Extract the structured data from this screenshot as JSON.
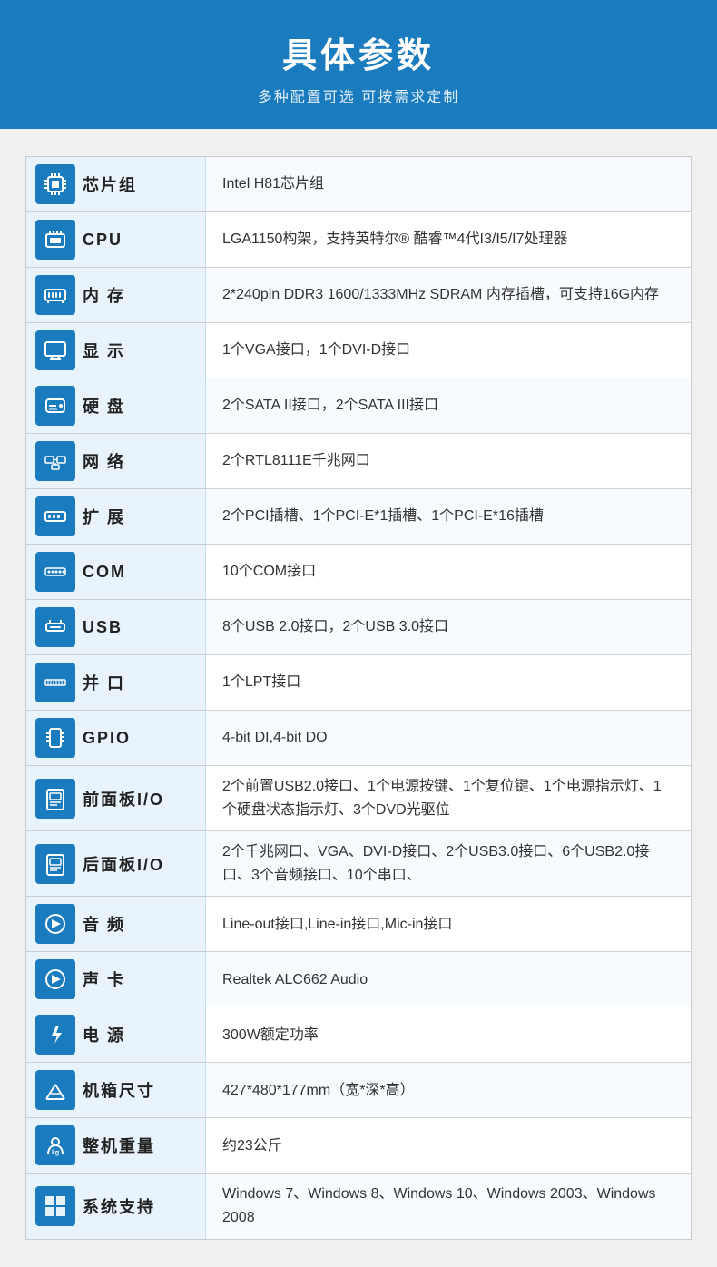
{
  "header": {
    "title": "具体参数",
    "subtitle": "多种配置可选 可按需求定制"
  },
  "rows": [
    {
      "id": "chipset",
      "icon": "🔲",
      "label": "芯片组",
      "value": "Intel H81芯片组"
    },
    {
      "id": "cpu",
      "icon": "🖥",
      "label": "CPU",
      "value": "LGA1150构架，支持英特尔® 酷睿™4代I3/I5/I7处理器"
    },
    {
      "id": "memory",
      "icon": "▦",
      "label": "内 存",
      "value": "2*240pin DDR3 1600/1333MHz SDRAM 内存插槽，可支持16G内存"
    },
    {
      "id": "display",
      "icon": "🖵",
      "label": "显 示",
      "value": "1个VGA接口，1个DVI-D接口"
    },
    {
      "id": "harddisk",
      "icon": "💽",
      "label": "硬 盘",
      "value": "2个SATA II接口，2个SATA III接口"
    },
    {
      "id": "network",
      "icon": "🖧",
      "label": "网 络",
      "value": "2个RTL8111E千兆网口"
    },
    {
      "id": "expand",
      "icon": "▣",
      "label": "扩 展",
      "value": "2个PCI插槽、1个PCI-E*1插槽、1个PCI-E*16插槽"
    },
    {
      "id": "com",
      "icon": "⬛",
      "label": "COM",
      "value": "10个COM接口"
    },
    {
      "id": "usb",
      "icon": "⬦",
      "label": "USB",
      "value": "8个USB 2.0接口，2个USB 3.0接口"
    },
    {
      "id": "parallel",
      "icon": "▬",
      "label": "并 口",
      "value": "1个LPT接口"
    },
    {
      "id": "gpio",
      "icon": "⬕",
      "label": "GPIO",
      "value": "4-bit DI,4-bit DO"
    },
    {
      "id": "front-panel",
      "icon": "🗋",
      "label": "前面板I/O",
      "value": "2个前置USB2.0接口、1个电源按键、1个复位键、1个电源指示灯、1个硬盘状态指示灯、3个DVD光驱位"
    },
    {
      "id": "rear-panel",
      "icon": "🗋",
      "label": "后面板I/O",
      "value": "2个千兆网口、VGA、DVI-D接口、2个USB3.0接口、6个USB2.0接口、3个音频接口、10个串口、"
    },
    {
      "id": "audio-port",
      "icon": "🔊",
      "label": "音 频",
      "value": "Line-out接口,Line-in接口,Mic-in接口"
    },
    {
      "id": "sound-card",
      "icon": "🔊",
      "label": "声 卡",
      "value": "Realtek ALC662 Audio"
    },
    {
      "id": "power",
      "icon": "⚡",
      "label": "电 源",
      "value": "300W额定功率"
    },
    {
      "id": "chassis",
      "icon": "✂",
      "label": "机箱尺寸",
      "value": "427*480*177mm（宽*深*高）"
    },
    {
      "id": "weight",
      "icon": "⚖",
      "label": "整机重量",
      "value": "约23公斤"
    },
    {
      "id": "os",
      "icon": "⊞",
      "label": "系统支持",
      "value": "Windows 7、Windows 8、Windows 10、Windows 2003、Windows 2008"
    }
  ],
  "icons": {
    "chipset": "&#9632;",
    "cpu": "&#9632;",
    "memory": "&#9632;",
    "display": "&#9632;",
    "harddisk": "&#9632;",
    "network": "&#9632;",
    "expand": "&#9632;",
    "com": "&#9632;",
    "usb": "&#9632;",
    "parallel": "&#9632;",
    "gpio": "&#9632;",
    "front-panel": "&#9632;",
    "rear-panel": "&#9632;",
    "audio-port": "&#9632;",
    "sound-card": "&#9632;",
    "power": "&#9632;",
    "chassis": "&#9632;",
    "weight": "&#9632;",
    "os": "&#9632;"
  }
}
